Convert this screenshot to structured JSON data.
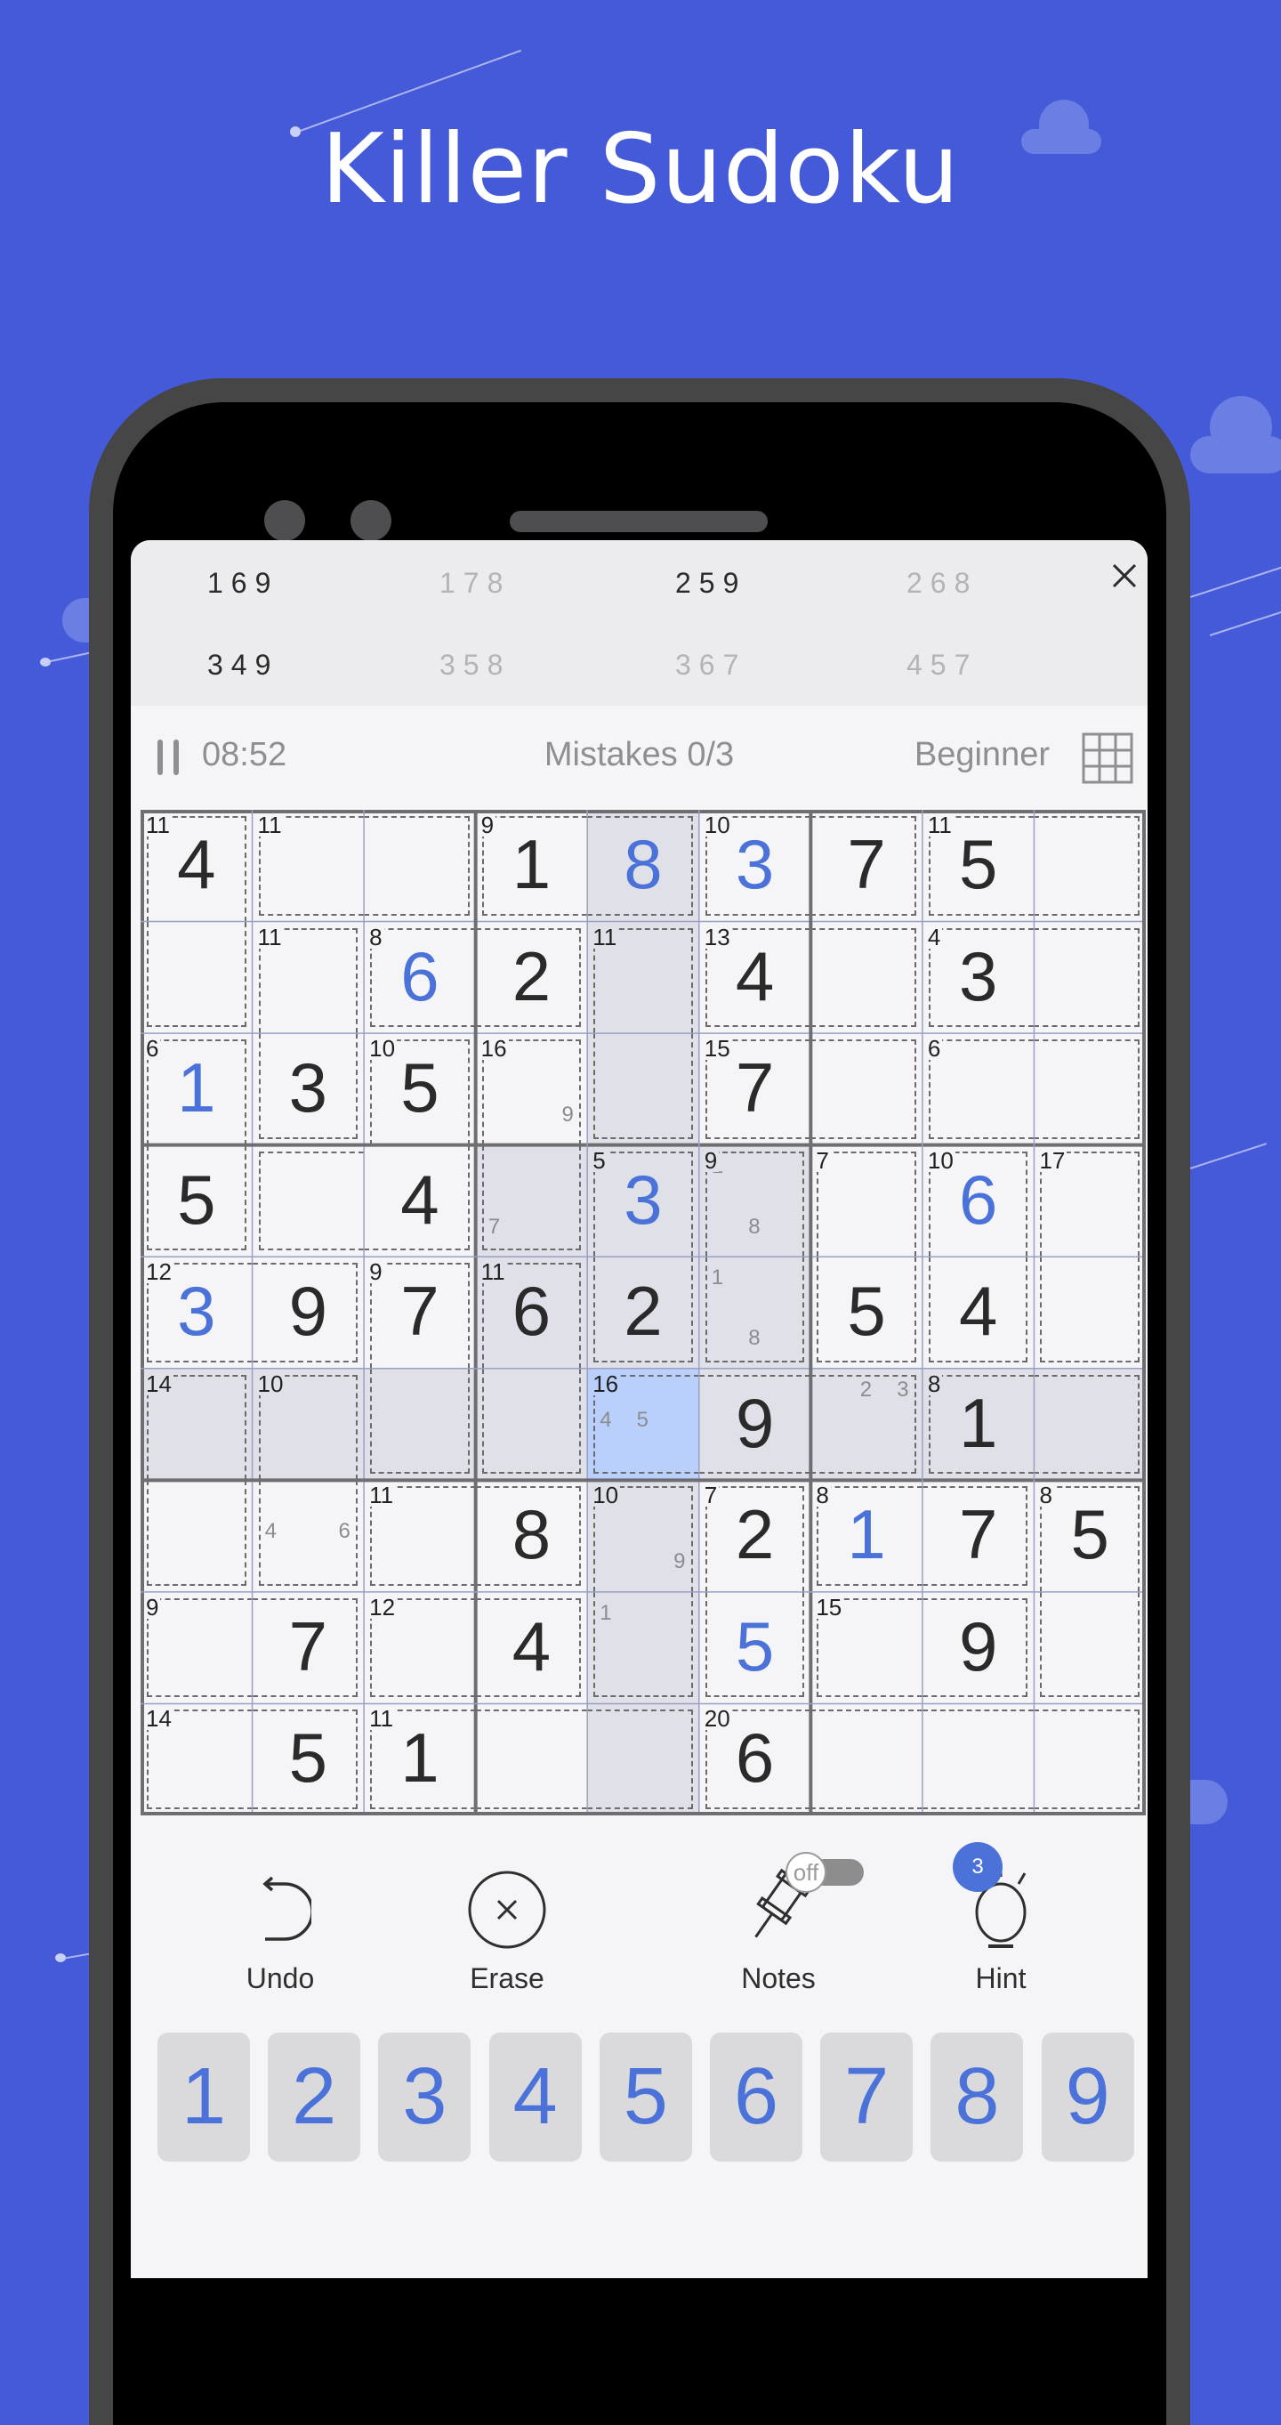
{
  "banner": {
    "title": "Killer Sudoku"
  },
  "combinations": {
    "items": [
      {
        "label": "169",
        "active": true
      },
      {
        "label": "178",
        "active": false
      },
      {
        "label": "259",
        "active": true
      },
      {
        "label": "268",
        "active": false
      },
      {
        "label": "349",
        "active": true
      },
      {
        "label": "358",
        "active": false
      },
      {
        "label": "367",
        "active": false
      },
      {
        "label": "457",
        "active": false
      }
    ],
    "close_icon": "close-icon"
  },
  "status": {
    "pause_icon": "pause-icon",
    "timer": "08:52",
    "mistakes": "Mistakes 0/3",
    "difficulty": "Beginner",
    "grid_icon": "grid-icon"
  },
  "board": {
    "givens_color": "#2a2a2a",
    "user_color": "#4a72d9",
    "highlight_color": "#dfe0e8",
    "selected_color": "#b9cffc",
    "selected": [
      5,
      4
    ],
    "cells": [
      [
        {
          "v": "4"
        },
        {
          "v": ""
        },
        {
          "v": ""
        },
        {
          "v": "1"
        },
        {
          "v": "8",
          "u": true
        },
        {
          "v": "3",
          "u": true
        },
        {
          "v": "7"
        },
        {
          "v": "5"
        },
        {
          "v": ""
        }
      ],
      [
        {
          "v": ""
        },
        {
          "v": ""
        },
        {
          "v": "6",
          "u": true
        },
        {
          "v": "2"
        },
        {
          "v": ""
        },
        {
          "v": "4"
        },
        {
          "v": ""
        },
        {
          "v": "3"
        },
        {
          "v": ""
        }
      ],
      [
        {
          "v": "1",
          "u": true
        },
        {
          "v": "3"
        },
        {
          "v": "5"
        },
        {
          "v": "",
          "n": [
            "9"
          ]
        },
        {
          "v": ""
        },
        {
          "v": "7"
        },
        {
          "v": ""
        },
        {
          "v": ""
        },
        {
          "v": ""
        }
      ],
      [
        {
          "v": "5"
        },
        {
          "v": ""
        },
        {
          "v": "4"
        },
        {
          "v": "",
          "n": [
            "7"
          ]
        },
        {
          "v": "3",
          "u": true
        },
        {
          "v": "",
          "n": [
            "1",
            "8"
          ]
        },
        {
          "v": ""
        },
        {
          "v": "6",
          "u": true
        },
        {
          "v": ""
        }
      ],
      [
        {
          "v": "3",
          "u": true
        },
        {
          "v": "9"
        },
        {
          "v": "7"
        },
        {
          "v": "6"
        },
        {
          "v": "2"
        },
        {
          "v": "",
          "n": [
            "1",
            "8"
          ]
        },
        {
          "v": "5"
        },
        {
          "v": "4"
        },
        {
          "v": ""
        }
      ],
      [
        {
          "v": ""
        },
        {
          "v": ""
        },
        {
          "v": ""
        },
        {
          "v": ""
        },
        {
          "v": "",
          "n": [
            "4",
            "5"
          ]
        },
        {
          "v": "9"
        },
        {
          "v": "",
          "n": [
            "2",
            "3"
          ]
        },
        {
          "v": "1"
        },
        {
          "v": ""
        }
      ],
      [
        {
          "v": ""
        },
        {
          "v": "",
          "n": [
            "4",
            "6"
          ]
        },
        {
          "v": ""
        },
        {
          "v": "8"
        },
        {
          "v": "",
          "n": [
            "9"
          ]
        },
        {
          "v": "2"
        },
        {
          "v": "1",
          "u": true
        },
        {
          "v": "7"
        },
        {
          "v": "5"
        }
      ],
      [
        {
          "v": ""
        },
        {
          "v": "7"
        },
        {
          "v": ""
        },
        {
          "v": "4"
        },
        {
          "v": "",
          "n": [
            "1"
          ]
        },
        {
          "v": "5",
          "u": true
        },
        {
          "v": ""
        },
        {
          "v": "9"
        },
        {
          "v": ""
        }
      ],
      [
        {
          "v": ""
        },
        {
          "v": "5"
        },
        {
          "v": "1"
        },
        {
          "v": ""
        },
        {
          "v": ""
        },
        {
          "v": "6"
        },
        {
          "v": ""
        },
        {
          "v": ""
        },
        {
          "v": ""
        }
      ]
    ],
    "cages": [
      {
        "sum": "11",
        "cells": [
          [
            0,
            0
          ],
          [
            1,
            0
          ]
        ]
      },
      {
        "sum": "11",
        "cells": [
          [
            0,
            1
          ],
          [
            0,
            2
          ]
        ]
      },
      {
        "sum": "9",
        "cells": [
          [
            0,
            3
          ],
          [
            0,
            4
          ]
        ]
      },
      {
        "sum": "10",
        "cells": [
          [
            0,
            5
          ],
          [
            0,
            6
          ]
        ]
      },
      {
        "sum": "11",
        "cells": [
          [
            0,
            7
          ],
          [
            0,
            8
          ]
        ]
      },
      {
        "sum": "11",
        "cells": [
          [
            1,
            1
          ],
          [
            2,
            1
          ]
        ]
      },
      {
        "sum": "8",
        "cells": [
          [
            1,
            2
          ],
          [
            1,
            3
          ]
        ]
      },
      {
        "sum": "11",
        "cells": [
          [
            1,
            4
          ],
          [
            2,
            4
          ]
        ]
      },
      {
        "sum": "13",
        "cells": [
          [
            1,
            5
          ],
          [
            1,
            6
          ]
        ]
      },
      {
        "sum": "4",
        "cells": [
          [
            1,
            7
          ],
          [
            1,
            8
          ]
        ]
      },
      {
        "sum": "6",
        "cells": [
          [
            2,
            0
          ],
          [
            3,
            0
          ]
        ]
      },
      {
        "sum": "10",
        "cells": [
          [
            2,
            2
          ],
          [
            3,
            2
          ],
          [
            3,
            1
          ]
        ]
      },
      {
        "sum": "16",
        "cells": [
          [
            2,
            3
          ],
          [
            3,
            3
          ]
        ]
      },
      {
        "sum": "15",
        "cells": [
          [
            2,
            5
          ],
          [
            2,
            6
          ]
        ]
      },
      {
        "sum": "6",
        "cells": [
          [
            2,
            7
          ],
          [
            2,
            8
          ]
        ]
      },
      {
        "sum": "5",
        "cells": [
          [
            3,
            4
          ],
          [
            4,
            4
          ]
        ]
      },
      {
        "sum": "9",
        "cells": [
          [
            3,
            5
          ],
          [
            4,
            5
          ]
        ]
      },
      {
        "sum": "7",
        "cells": [
          [
            3,
            6
          ],
          [
            4,
            6
          ]
        ]
      },
      {
        "sum": "10",
        "cells": [
          [
            3,
            7
          ],
          [
            4,
            7
          ]
        ]
      },
      {
        "sum": "17",
        "cells": [
          [
            3,
            8
          ],
          [
            4,
            8
          ]
        ]
      },
      {
        "sum": "12",
        "cells": [
          [
            4,
            0
          ],
          [
            4,
            1
          ]
        ]
      },
      {
        "sum": "9",
        "cells": [
          [
            4,
            2
          ],
          [
            5,
            2
          ]
        ]
      },
      {
        "sum": "11",
        "cells": [
          [
            4,
            3
          ],
          [
            5,
            3
          ]
        ]
      },
      {
        "sum": "14",
        "cells": [
          [
            5,
            0
          ],
          [
            6,
            0
          ]
        ]
      },
      {
        "sum": "10",
        "cells": [
          [
            5,
            1
          ],
          [
            6,
            1
          ]
        ]
      },
      {
        "sum": "16",
        "cells": [
          [
            5,
            4
          ],
          [
            5,
            5
          ],
          [
            5,
            6
          ]
        ]
      },
      {
        "sum": "8",
        "cells": [
          [
            5,
            7
          ],
          [
            5,
            8
          ]
        ]
      },
      {
        "sum": "11",
        "cells": [
          [
            6,
            2
          ],
          [
            6,
            3
          ]
        ]
      },
      {
        "sum": "10",
        "cells": [
          [
            6,
            4
          ],
          [
            7,
            4
          ]
        ]
      },
      {
        "sum": "7",
        "cells": [
          [
            6,
            5
          ],
          [
            7,
            5
          ]
        ]
      },
      {
        "sum": "8",
        "cells": [
          [
            6,
            6
          ],
          [
            6,
            7
          ]
        ]
      },
      {
        "sum": "8",
        "cells": [
          [
            6,
            8
          ],
          [
            7,
            8
          ]
        ]
      },
      {
        "sum": "9",
        "cells": [
          [
            7,
            0
          ],
          [
            7,
            1
          ]
        ]
      },
      {
        "sum": "12",
        "cells": [
          [
            7,
            2
          ],
          [
            7,
            3
          ]
        ]
      },
      {
        "sum": "15",
        "cells": [
          [
            7,
            6
          ],
          [
            7,
            7
          ]
        ]
      },
      {
        "sum": "14",
        "cells": [
          [
            8,
            0
          ],
          [
            8,
            1
          ]
        ]
      },
      {
        "sum": "11",
        "cells": [
          [
            8,
            2
          ],
          [
            8,
            3
          ],
          [
            8,
            4
          ]
        ]
      },
      {
        "sum": "20",
        "cells": [
          [
            8,
            5
          ],
          [
            8,
            6
          ],
          [
            8,
            7
          ],
          [
            8,
            8
          ]
        ]
      }
    ]
  },
  "actions": {
    "undo": {
      "label": "Undo",
      "icon": "undo-icon"
    },
    "erase": {
      "label": "Erase",
      "icon": "erase-icon"
    },
    "notes": {
      "label": "Notes",
      "icon": "pin-icon",
      "toggle": "off"
    },
    "hint": {
      "label": "Hint",
      "icon": "lightbulb-icon",
      "count": "3"
    }
  },
  "numpad": {
    "keys": [
      "1",
      "2",
      "3",
      "4",
      "5",
      "6",
      "7",
      "8",
      "9"
    ]
  }
}
